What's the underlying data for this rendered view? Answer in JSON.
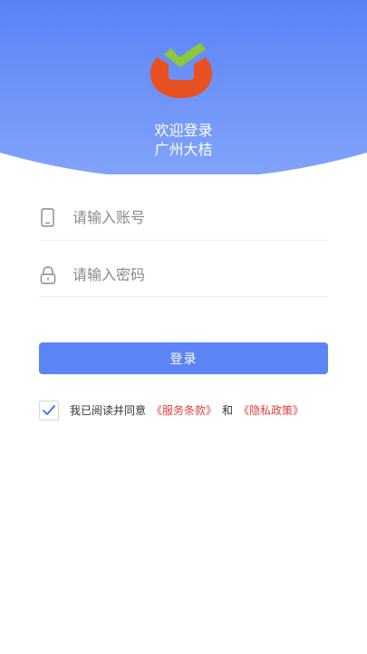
{
  "header": {
    "welcome": "欢迎登录",
    "company": "广州大桔"
  },
  "logo": {
    "icon": "orange-checkmark-logo",
    "orange": "#e85122",
    "green": "#8cc83c"
  },
  "form": {
    "account_placeholder": "请输入账号",
    "account_icon": "phone-icon",
    "password_placeholder": "请输入密码",
    "password_icon": "lock-icon"
  },
  "login_button": {
    "label": "登录"
  },
  "agreement": {
    "checked": true,
    "prefix": "我已阅读并同意",
    "terms_link": "《服务条款》",
    "and": "和",
    "privacy_link": "《隐私政策》"
  },
  "colors": {
    "header_gradient_top": "#5a82f5",
    "header_gradient_bottom": "#7ea1fb",
    "primary": "#5b84f5",
    "link": "#e53b3b"
  }
}
